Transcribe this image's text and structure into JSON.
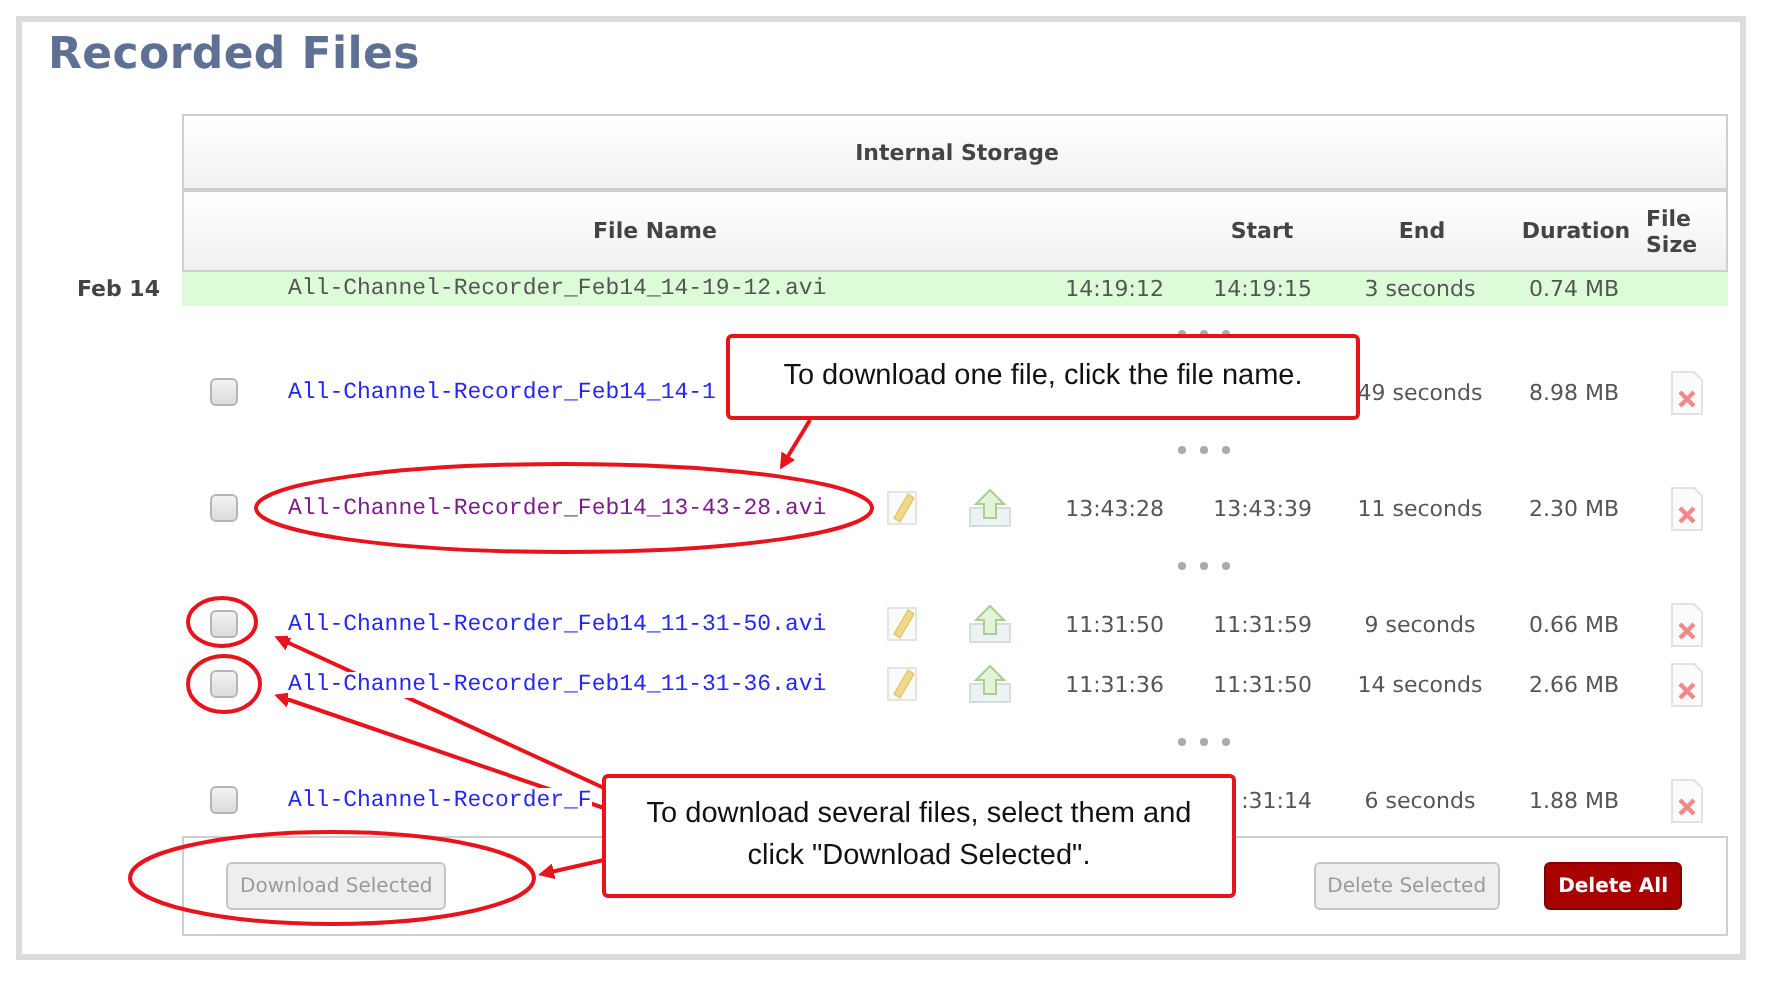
{
  "title": "Recorded Files",
  "storage": {
    "title": "Internal Storage"
  },
  "columns": [
    "File Name",
    "Start",
    "End",
    "Duration",
    "File Size"
  ],
  "rows": [
    {
      "kind": "current",
      "date": "Feb 14",
      "name": "All-Channel-Recorder_Feb14_14-19-12.avi",
      "start": "14:19:12",
      "end": "14:19:15",
      "duration": "3 seconds",
      "size": "0.74 MB"
    },
    {
      "kind": "gap"
    },
    {
      "kind": "file",
      "checked": false,
      "visited": false,
      "name": "All-Channel-Recorder_Feb14_14-1",
      "duration": "49 seconds",
      "size": "8.98 MB"
    },
    {
      "kind": "gap"
    },
    {
      "kind": "file",
      "checked": false,
      "visited": true,
      "name": "All-Channel-Recorder_Feb14_13-43-28.avi",
      "start": "13:43:28",
      "end": "13:43:39",
      "duration": "11 seconds",
      "size": "2.30 MB"
    },
    {
      "kind": "gap"
    },
    {
      "kind": "file",
      "checked": false,
      "visited": false,
      "name": "All-Channel-Recorder_Feb14_11-31-50.avi",
      "start": "11:31:50",
      "end": "11:31:59",
      "duration": "9 seconds",
      "size": "0.66 MB"
    },
    {
      "kind": "file",
      "checked": false,
      "visited": false,
      "name": "All-Channel-Recorder_Feb14_11-31-36.avi",
      "start": "11:31:36",
      "end": "11:31:50",
      "duration": "14 seconds",
      "size": "2.66 MB"
    },
    {
      "kind": "gap"
    },
    {
      "kind": "file",
      "checked": false,
      "visited": false,
      "name": "All-Channel-Recorder_F",
      "end": ":31:14",
      "duration": "6 seconds",
      "size": "1.88 MB"
    }
  ],
  "buttons": [
    {
      "label": "Download Selected",
      "kind": "plain",
      "disabled": true
    },
    {
      "label": "Delete Selected",
      "kind": "plain",
      "disabled": true
    },
    {
      "label": "Delete All",
      "kind": "danger",
      "disabled": false
    }
  ],
  "callouts": [
    {
      "text": "To download one file, click the file name."
    },
    {
      "text": "To download several files, select them and click \"Download Selected\"."
    }
  ]
}
